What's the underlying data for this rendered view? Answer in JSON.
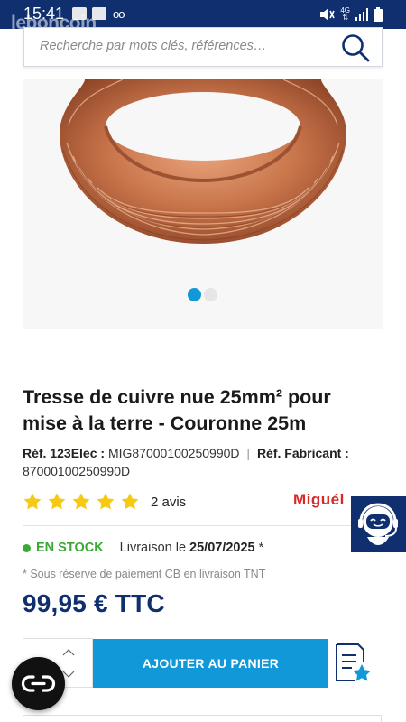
{
  "status_bar": {
    "time": "15:41",
    "voicemail_icon": "oo",
    "network": "4G"
  },
  "watermark": "leboncoin",
  "search": {
    "placeholder": "Recherche par mots clés, références…",
    "icon": "search-icon"
  },
  "gallery": {
    "image_count": 2,
    "active_index": 0
  },
  "product": {
    "title": "Tresse de cuivre nue 25mm² pour mise à la terre - Couronne 25m",
    "ref_label": "Réf. 123Elec :",
    "ref_value": "MIG87000100250990D",
    "separator": "|",
    "manufacturer_label": "Réf. Fabricant :",
    "manufacturer_value": "87000100250990D",
    "rating_stars": 5,
    "reviews": "2 avis",
    "brand": "Miguél",
    "stock": "EN STOCK",
    "delivery_label": "Livraison le",
    "delivery_date": "25/07/2025",
    "delivery_mark": "*",
    "note": "* Sous réserve de paiement CB en livraison TNT",
    "price": "99,95 €  TTC"
  },
  "cart": {
    "add_label": "AJOUTER AU PANIER"
  },
  "colors": {
    "navy": "#0f2f6f",
    "accent_blue": "#1098d8",
    "stock_green": "#3aaa35",
    "star_yellow": "#f6c913",
    "brand_red": "#d62a2a",
    "copper": "#c8744a"
  }
}
